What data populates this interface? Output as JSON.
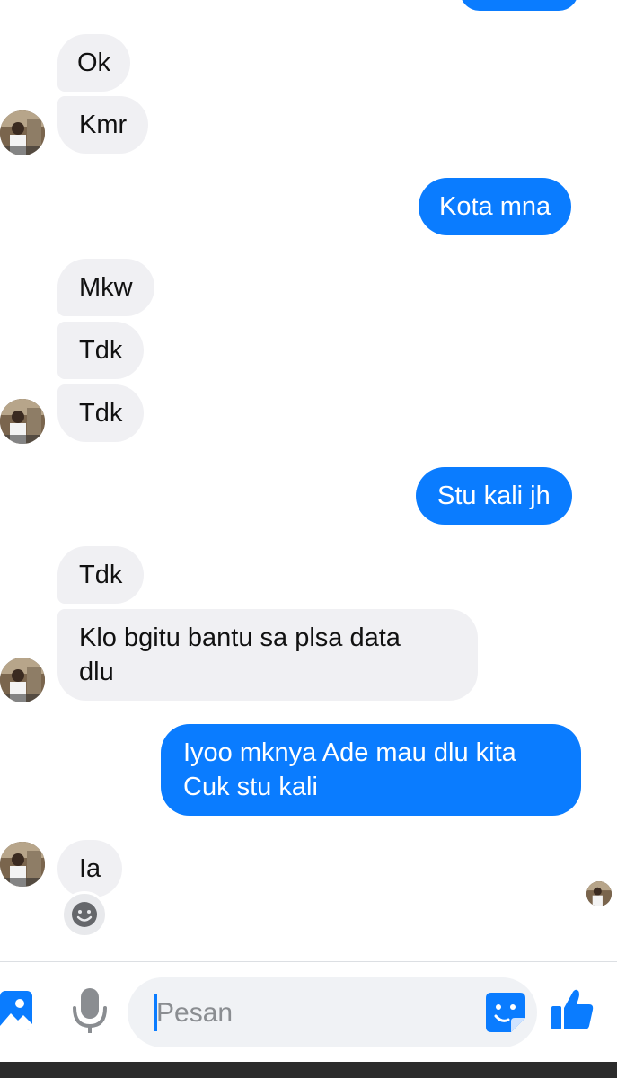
{
  "colors": {
    "outgoing_bubble": "#0a7cff",
    "incoming_bubble": "#f0f0f3",
    "accent": "#0a7cff"
  },
  "messages": [
    {
      "direction": "in",
      "text": "Ok"
    },
    {
      "direction": "in",
      "text": "Kmr"
    },
    {
      "direction": "out",
      "text": "Kota mna"
    },
    {
      "direction": "in",
      "text": "Mkw"
    },
    {
      "direction": "in",
      "text": "Tdk"
    },
    {
      "direction": "in",
      "text": "Tdk"
    },
    {
      "direction": "out",
      "text": "Stu kali jh"
    },
    {
      "direction": "in",
      "text": "Tdk"
    },
    {
      "direction": "in",
      "line1": "Klo bgitu bantu sa plsa data",
      "line2": "dlu"
    },
    {
      "direction": "out",
      "line1": "Iyoo mknya Ade mau dlu kita",
      "line2": "Cuk stu kali"
    },
    {
      "direction": "in",
      "text": "Ia"
    }
  ],
  "reaction": {
    "icon": "smiley-icon"
  },
  "composer": {
    "placeholder": "Pesan",
    "icons": [
      "image-icon",
      "microphone-icon",
      "sticker-icon",
      "thumbs-up-icon"
    ]
  }
}
